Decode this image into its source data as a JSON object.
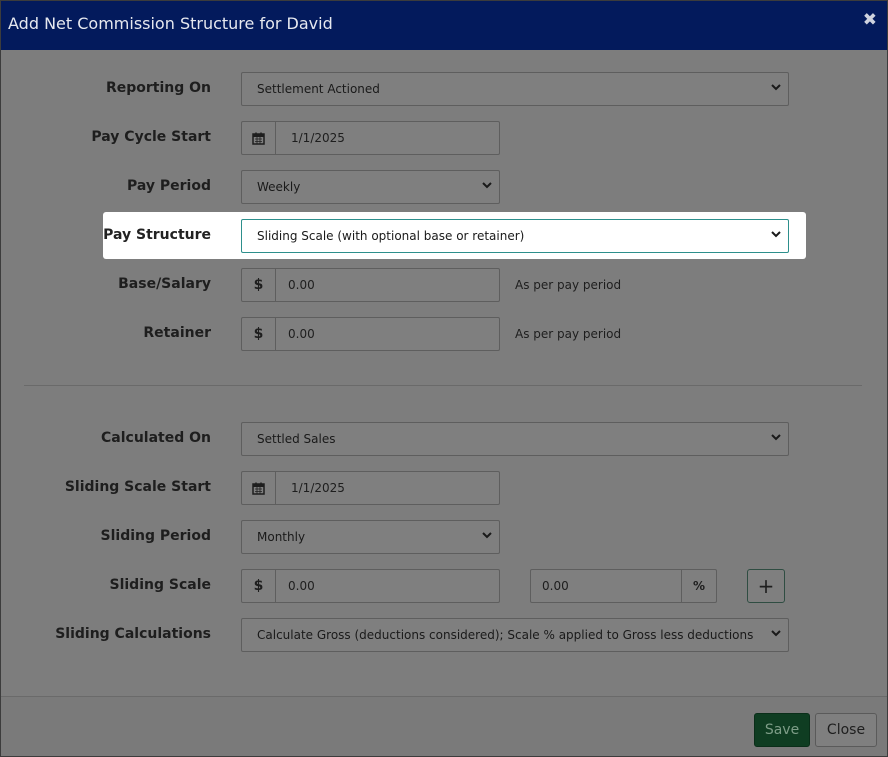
{
  "dialog": {
    "title": "Add Net Commission Structure for David",
    "close_glyph": "✖"
  },
  "fields": {
    "reporting_on": {
      "label": "Reporting On",
      "value": "Settlement Actioned"
    },
    "pay_cycle_start": {
      "label": "Pay Cycle Start",
      "value": "1/1/2025"
    },
    "pay_period": {
      "label": "Pay Period",
      "value": "Weekly"
    },
    "pay_structure": {
      "label": "Pay Structure",
      "value": "Sliding Scale (with optional base or retainer)"
    },
    "base_salary": {
      "label": "Base/Salary",
      "value": "0.00",
      "prefix": "$",
      "hint": "As per pay period"
    },
    "retainer": {
      "label": "Retainer",
      "value": "0.00",
      "prefix": "$",
      "hint": "As per pay period"
    },
    "calculated_on": {
      "label": "Calculated On",
      "value": "Settled Sales"
    },
    "sliding_scale_start": {
      "label": "Sliding Scale Start",
      "value": "1/1/2025"
    },
    "sliding_period": {
      "label": "Sliding Period",
      "value": "Monthly"
    },
    "sliding_scale": {
      "label": "Sliding Scale",
      "amount": "0.00",
      "prefix": "$",
      "percent": "0.00",
      "suffix": "%",
      "add_glyph": "+"
    },
    "sliding_calculations": {
      "label": "Sliding Calculations",
      "value": "Calculate Gross (deductions considered); Scale % applied to Gross less deductions"
    }
  },
  "footer": {
    "save_label": "Save",
    "close_label": "Close"
  },
  "icons": {
    "calendar": "calendar-icon",
    "chevron": "chevron-down-icon"
  },
  "colors": {
    "titlebar": "#031a5c",
    "save_button": "#0f3d22",
    "highlight_border": "#2d8f8c"
  }
}
